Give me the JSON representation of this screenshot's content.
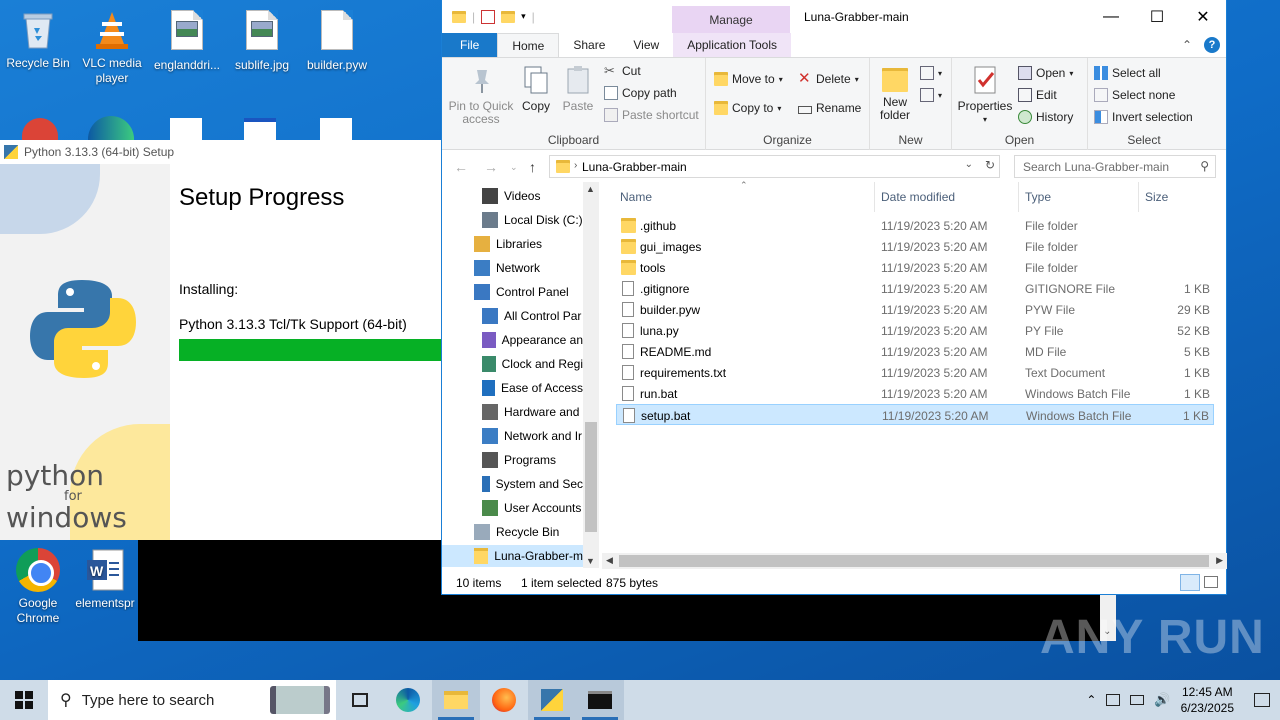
{
  "desktop": {
    "icons_top": [
      {
        "label": "Recycle Bin",
        "icon": "recycle-bin-icon"
      },
      {
        "label": "VLC media player",
        "icon": "vlc-icon"
      },
      {
        "label": "englanddri...",
        "icon": "image-file-icon"
      },
      {
        "label": "sublife.jpg",
        "icon": "image-file-icon"
      },
      {
        "label": "builder.pyw",
        "icon": "file-icon"
      }
    ],
    "icons_bottom": [
      {
        "label": "Google Chrome",
        "icon": "chrome-icon"
      },
      {
        "label": "elementspr",
        "icon": "word-doc-icon"
      }
    ]
  },
  "python_setup": {
    "title": "Python 3.13.3 (64-bit) Setup",
    "heading": "Setup Progress",
    "installing_label": "Installing:",
    "package": "Python 3.13.3 Tcl/Tk Support (64-bit)",
    "progress": 1.0,
    "brand_word1": "python",
    "brand_for": "for",
    "brand_word2": "windows"
  },
  "explorer": {
    "title": "Luna-Grabber-main",
    "manage_tab": "Manage",
    "tabs": [
      "File",
      "Home",
      "Share",
      "View",
      "Application Tools"
    ],
    "active_tab": "Home",
    "ribbon": {
      "clipboard": {
        "label": "Clipboard",
        "pin": "Pin to Quick access",
        "copy": "Copy",
        "paste": "Paste",
        "cut": "Cut",
        "copy_path": "Copy path",
        "paste_shortcut": "Paste shortcut"
      },
      "organize": {
        "label": "Organize",
        "move_to": "Move to",
        "copy_to": "Copy to",
        "delete": "Delete",
        "rename": "Rename"
      },
      "new": {
        "label": "New",
        "new_folder": "New folder"
      },
      "open": {
        "label": "Open",
        "properties": "Properties",
        "open": "Open",
        "edit": "Edit",
        "history": "History"
      },
      "select": {
        "label": "Select",
        "select_all": "Select all",
        "select_none": "Select none",
        "invert": "Invert selection"
      }
    },
    "address": "Luna-Grabber-main",
    "search_placeholder": "Search Luna-Grabber-main",
    "nav_items": [
      {
        "label": "Videos",
        "icon": "videos-icon",
        "indent": 1
      },
      {
        "label": "Local Disk (C:)",
        "icon": "drive-icon",
        "indent": 1
      },
      {
        "label": "Libraries",
        "icon": "libraries-icon",
        "indent": 0
      },
      {
        "label": "Network",
        "icon": "network-icon",
        "indent": 0
      },
      {
        "label": "Control Panel",
        "icon": "control-panel-icon",
        "indent": 0
      },
      {
        "label": "All Control Par",
        "icon": "control-panel-icon",
        "indent": 1
      },
      {
        "label": "Appearance an",
        "icon": "appearance-icon",
        "indent": 1
      },
      {
        "label": "Clock and Regi",
        "icon": "clock-icon",
        "indent": 1
      },
      {
        "label": "Ease of Access",
        "icon": "ease-of-access-icon",
        "indent": 1
      },
      {
        "label": "Hardware and",
        "icon": "hardware-icon",
        "indent": 1
      },
      {
        "label": "Network and Ir",
        "icon": "network-icon",
        "indent": 1
      },
      {
        "label": "Programs",
        "icon": "programs-icon",
        "indent": 1
      },
      {
        "label": "System and Sec",
        "icon": "shield-icon",
        "indent": 1
      },
      {
        "label": "User Accounts",
        "icon": "users-icon",
        "indent": 1
      },
      {
        "label": "Recycle Bin",
        "icon": "recycle-bin-icon",
        "indent": 0
      },
      {
        "label": "Luna-Grabber-m",
        "icon": "folder-icon",
        "indent": 0,
        "selected": true
      }
    ],
    "columns": {
      "name": "Name",
      "date": "Date modified",
      "type": "Type",
      "size": "Size"
    },
    "files": [
      {
        "name": ".github",
        "date": "11/19/2023 5:20 AM",
        "type": "File folder",
        "size": "",
        "icon": "folder"
      },
      {
        "name": "gui_images",
        "date": "11/19/2023 5:20 AM",
        "type": "File folder",
        "size": "",
        "icon": "folder"
      },
      {
        "name": "tools",
        "date": "11/19/2023 5:20 AM",
        "type": "File folder",
        "size": "",
        "icon": "folder"
      },
      {
        "name": ".gitignore",
        "date": "11/19/2023 5:20 AM",
        "type": "GITIGNORE File",
        "size": "1 KB",
        "icon": "doc"
      },
      {
        "name": "builder.pyw",
        "date": "11/19/2023 5:20 AM",
        "type": "PYW File",
        "size": "29 KB",
        "icon": "doc"
      },
      {
        "name": "luna.py",
        "date": "11/19/2023 5:20 AM",
        "type": "PY File",
        "size": "52 KB",
        "icon": "doc"
      },
      {
        "name": "README.md",
        "date": "11/19/2023 5:20 AM",
        "type": "MD File",
        "size": "5 KB",
        "icon": "doc"
      },
      {
        "name": "requirements.txt",
        "date": "11/19/2023 5:20 AM",
        "type": "Text Document",
        "size": "1 KB",
        "icon": "doc"
      },
      {
        "name": "run.bat",
        "date": "11/19/2023 5:20 AM",
        "type": "Windows Batch File",
        "size": "1 KB",
        "icon": "bat"
      },
      {
        "name": "setup.bat",
        "date": "11/19/2023 5:20 AM",
        "type": "Windows Batch File",
        "size": "1 KB",
        "icon": "bat",
        "selected": true
      }
    ],
    "status": {
      "items": "10 items",
      "selected": "1 item selected",
      "size": "875 bytes"
    }
  },
  "watermark": "ANY RUN",
  "taskbar": {
    "search_placeholder": "Type here to search",
    "apps": [
      "task-view-icon",
      "edge-icon",
      "file-explorer-icon",
      "firefox-icon",
      "python-setup-icon",
      "terminal-icon"
    ],
    "active_app": "file-explorer-icon",
    "time": "12:45 AM",
    "date": "6/23/2025"
  },
  "colors": {
    "accent": "#1979ca",
    "selection": "#cce8ff",
    "progress": "#06b025",
    "manage_tab": "#e9d5f3"
  }
}
